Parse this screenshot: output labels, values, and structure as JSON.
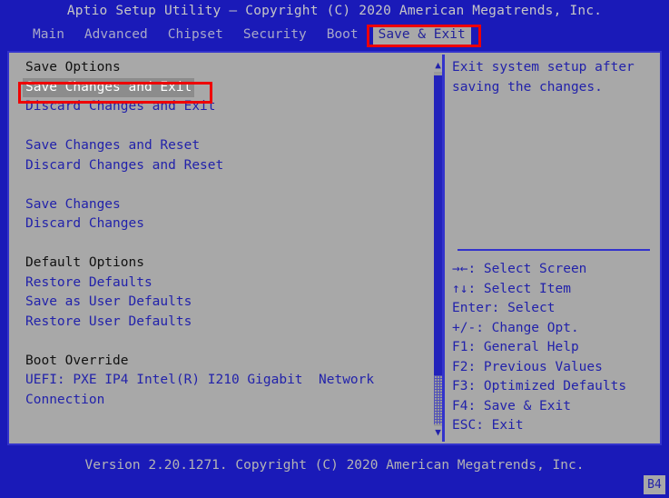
{
  "title": "Aptio Setup Utility – Copyright (C) 2020 American Megatrends, Inc.",
  "menu": {
    "items": [
      {
        "label": "Main",
        "active": false
      },
      {
        "label": "Advanced",
        "active": false
      },
      {
        "label": "Chipset",
        "active": false
      },
      {
        "label": "Security",
        "active": false
      },
      {
        "label": "Boot",
        "active": false
      },
      {
        "label": "Save & Exit",
        "active": true
      }
    ]
  },
  "left_panel": {
    "rows": [
      {
        "text": "Save Options",
        "style": "header"
      },
      {
        "text": "Save Changes and Exit",
        "style": "selected"
      },
      {
        "text": "Discard Changes and Exit",
        "style": "item"
      },
      {
        "text": "",
        "style": "spacer"
      },
      {
        "text": "Save Changes and Reset",
        "style": "item"
      },
      {
        "text": "Discard Changes and Reset",
        "style": "item"
      },
      {
        "text": "",
        "style": "spacer"
      },
      {
        "text": "Save Changes",
        "style": "item"
      },
      {
        "text": "Discard Changes",
        "style": "item"
      },
      {
        "text": "",
        "style": "spacer"
      },
      {
        "text": "Default Options",
        "style": "header"
      },
      {
        "text": "Restore Defaults",
        "style": "item"
      },
      {
        "text": "Save as User Defaults",
        "style": "item"
      },
      {
        "text": "Restore User Defaults",
        "style": "item"
      },
      {
        "text": "",
        "style": "spacer"
      },
      {
        "text": "Boot Override",
        "style": "header"
      },
      {
        "text": "UEFI: PXE IP4 Intel(R) I210 Gigabit  Network",
        "style": "item"
      },
      {
        "text": "Connection",
        "style": "item"
      }
    ]
  },
  "scrollbar": {
    "up_arrow": "▲",
    "down_arrow": "▼"
  },
  "right_panel": {
    "help_lines": [
      "Exit system setup after",
      "saving the changes."
    ],
    "legend": [
      "→←: Select Screen",
      "↑↓: Select Item",
      "Enter: Select",
      "+/-: Change Opt.",
      "F1: General Help",
      "F2: Previous Values",
      "F3: Optimized Defaults",
      "F4: Save & Exit",
      "ESC: Exit"
    ]
  },
  "footer": {
    "version": "Version 2.20.1271. Copyright (C) 2020 American Megatrends, Inc.",
    "badge": "B4"
  },
  "colors": {
    "background_blue": "#1a1ab8",
    "panel_gray": "#a8a8a8",
    "text_blue": "#2222aa",
    "text_black": "#111111",
    "selected_bg": "#8c8c8c",
    "selected_fg": "#ffffff",
    "annotation_red": "#ee0000",
    "border_blue": "#3333cc"
  }
}
